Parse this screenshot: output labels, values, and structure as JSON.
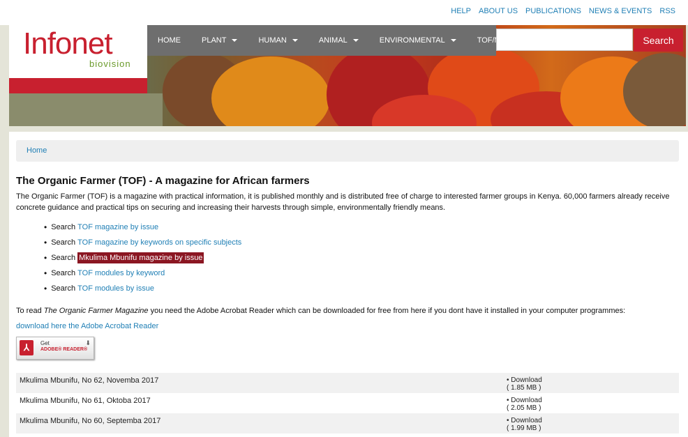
{
  "top_links": [
    "HELP",
    "ABOUT US",
    "PUBLICATIONS",
    "NEWS & EVENTS",
    "RSS"
  ],
  "logo": {
    "main": "Infonet",
    "sub": "biovision"
  },
  "nav": [
    {
      "label": "HOME",
      "dropdown": false
    },
    {
      "label": "PLANT",
      "dropdown": true
    },
    {
      "label": "HUMAN",
      "dropdown": true
    },
    {
      "label": "ANIMAL",
      "dropdown": true
    },
    {
      "label": "ENVIRONMENTAL",
      "dropdown": true
    },
    {
      "label": "TOF/MKM",
      "dropdown": false
    }
  ],
  "search": {
    "placeholder": "",
    "button": "Search"
  },
  "breadcrumb": "Home",
  "page": {
    "title": "The Organic Farmer (TOF) - A magazine for African farmers",
    "intro": "The Organic Farmer (TOF) is a magazine with practical information, it is published monthly and is distributed free of charge to interested farmer groups in Kenya. 60,000 farmers already receive concrete guidance and practical tips on securing and increasing their harvests through simple, environmentally friendly means.",
    "search_prefix": "Search",
    "search_links": [
      "TOF magazine by issue",
      "TOF magazine by keywords on specific subjects",
      "Mkulima Mbunifu magazine by issue",
      "TOF modules by keyword",
      "TOF modules by issue"
    ],
    "read_prefix": "To read ",
    "read_italic": "The Organic Farmer Magazine",
    "read_suffix": " you need the Adobe Acrobat Reader which can be downloaded for free from here if you dont have it installed in your computer programmes:",
    "download_reader": "download here the Adobe Acrobat Reader",
    "adobe_badge": {
      "get": "Get",
      "name": "ADOBE® READER®"
    }
  },
  "issues": [
    {
      "name": "Mkulima Mbunifu, No 62, Novemba 2017",
      "download": "Download",
      "size": "( 1.85 MB )"
    },
    {
      "name": "Mkulima Mbunifu, No 61, Oktoba 2017",
      "download": "Download",
      "size": "( 2.05 MB )"
    },
    {
      "name": "Mkulima Mbunifu, No 60, Septemba 2017",
      "download": "Download",
      "size": "( 1.99 MB )"
    }
  ],
  "colors": {
    "brand_red": "#c8202f",
    "link_blue": "#1f7fb5",
    "highlight": "#8b1622",
    "nav_gray": "#6e6e6e"
  }
}
